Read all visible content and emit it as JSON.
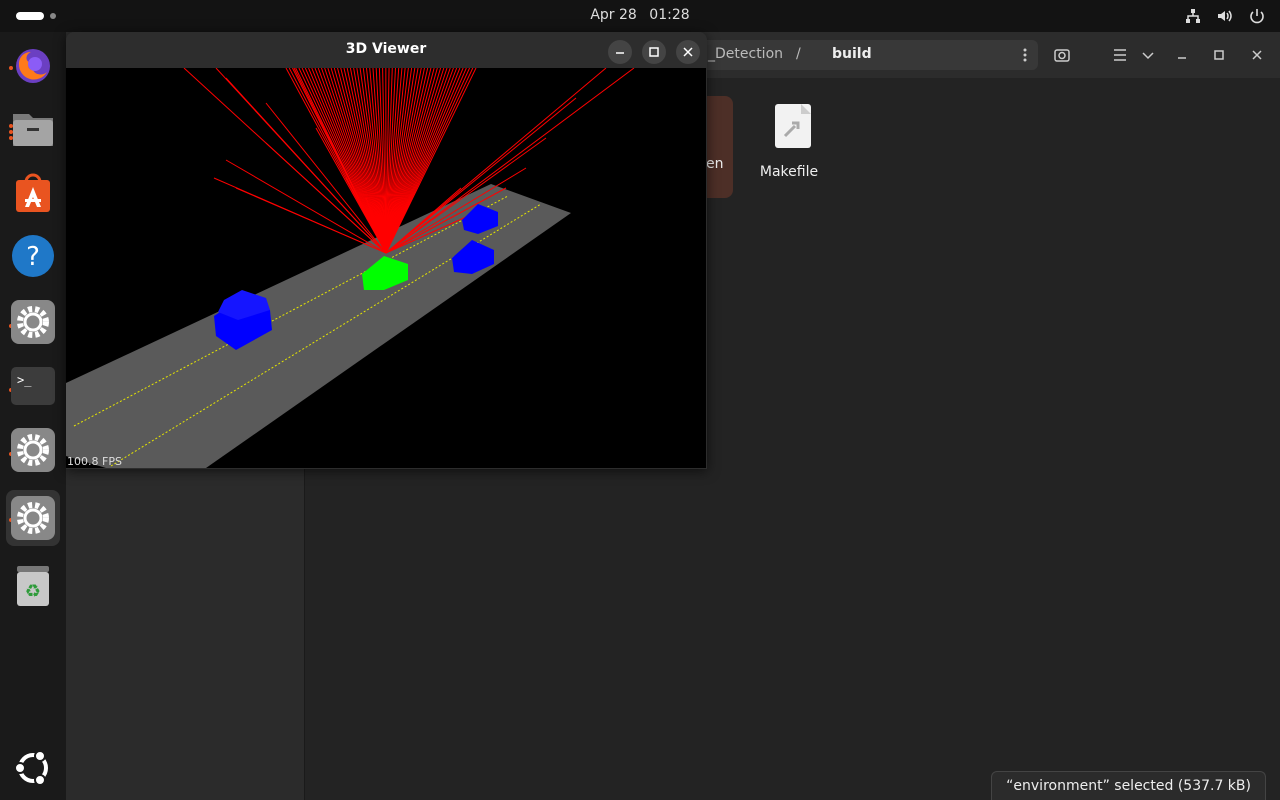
{
  "topbar": {
    "date": "Apr 28",
    "time": "01:28"
  },
  "dock": {
    "items": [
      {
        "name": "firefox",
        "icon": "firefox-icon",
        "color": "#e66000"
      },
      {
        "name": "files",
        "icon": "files-icon",
        "color": "#8c8c8c"
      },
      {
        "name": "app-center",
        "icon": "app-center-icon",
        "color": "#e95420"
      },
      {
        "name": "help",
        "icon": "help-icon",
        "color": "#1f78c8"
      },
      {
        "name": "settings",
        "icon": "gear-icon",
        "color": "#9a9a9a"
      },
      {
        "name": "terminal",
        "icon": "terminal-icon",
        "color": "#3c3c3c"
      },
      {
        "name": "settings-2",
        "icon": "gear-icon",
        "color": "#9a9a9a"
      },
      {
        "name": "settings-3",
        "icon": "gear-icon",
        "color": "#9a9a9a"
      },
      {
        "name": "trash",
        "icon": "trash-icon",
        "color": "#bdbdbd"
      }
    ],
    "show_apps_icon": "ubuntu-logo-icon"
  },
  "files": {
    "path": {
      "parent_partial": "_Detection",
      "separator": "/",
      "current": "build"
    },
    "items": [
      {
        "label": "en",
        "icon": "folder-icon",
        "selected": true
      },
      {
        "label": "Makefile",
        "icon": "makefile-icon",
        "selected": false
      }
    ],
    "status": "“environment” selected  (537.7 kB)"
  },
  "viewer": {
    "title": "3D Viewer",
    "fps": "100.8 FPS",
    "colors": {
      "road": "#5a5a5a",
      "lane": "#e6e600",
      "ego": "#00ff00",
      "obstacle": "#0000ff",
      "ray": "#ff0000"
    }
  }
}
